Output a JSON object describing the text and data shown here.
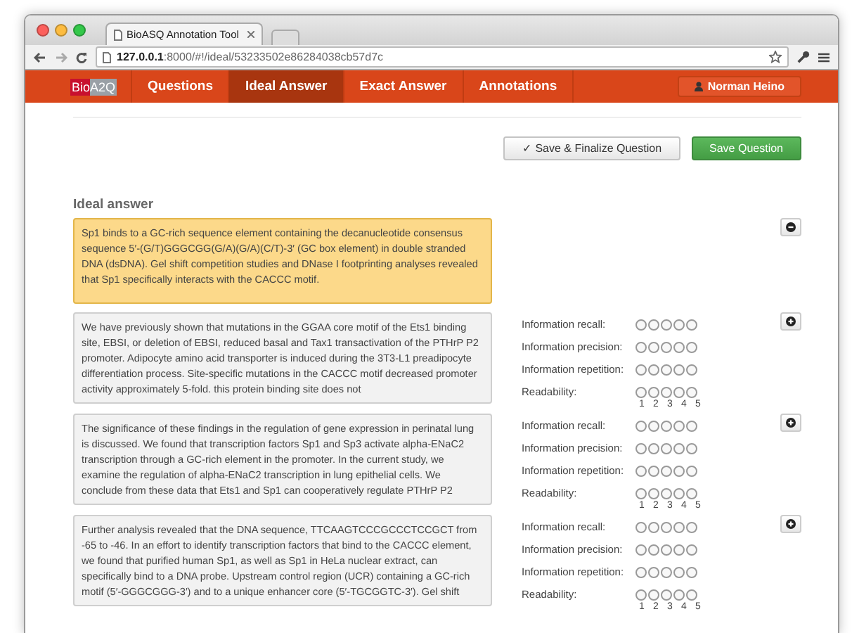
{
  "browser": {
    "tab_title": "BioASQ Annotation Tool",
    "url": "**127.0.0.1**:8000/#!/ideal/53233502e86284038cb57d7c"
  },
  "navbar": {
    "logo": {
      "part_1": "Bio",
      "part_2": "A2Q"
    },
    "items": [
      {
        "label": "Questions",
        "selected": false
      },
      {
        "label": "Ideal Answer",
        "selected": true
      },
      {
        "label": "Exact Answer",
        "selected": false
      },
      {
        "label": "Annotations",
        "selected": false
      }
    ],
    "user": "Norman Heino"
  },
  "actions": {
    "finalize": "✓ Save & Finalize Question",
    "save": "Save Question"
  },
  "ideal_answer": {
    "heading": "Ideal answer",
    "text": "Sp1 binds to a GC-rich sequence element containing the decanucleotide consensus sequence 5′-(G/T)GGGCGG(G/A)(G/A)(C/T)-3′ (GC box element) in double stranded DNA (dsDNA). Gel shift competition studies and DNase I footprinting analyses revealed that Sp1 specifically interacts with the CACCC motif."
  },
  "snippets": [
    {
      "text": "We have previously shown that mutations in the GGAA core motif of the Ets1 binding site, EBSI, or deletion of EBSI, reduced basal and Tax1 transactivation of the PTHrP P2 promoter. Adipocyte amino acid transporter is induced during the 3T3-L1 preadipocyte differentiation process. Site-specific mutations in the CACCC motif decreased promoter activity approximately 5-fold. this protein binding site does not",
      "criteria": [
        {
          "label": "Information recall:",
          "radios": [
            {
              "selected": false
            },
            {
              "selected": false
            },
            {
              "selected": false
            },
            {
              "selected": false
            },
            {
              "selected": false
            }
          ]
        },
        {
          "label": "Information precision:",
          "radios": [
            {
              "selected": false
            },
            {
              "selected": false
            },
            {
              "selected": false
            },
            {
              "selected": false
            },
            {
              "selected": false
            }
          ]
        },
        {
          "label": "Information repetition:",
          "radios": [
            {
              "selected": false
            },
            {
              "selected": false
            },
            {
              "selected": false
            },
            {
              "selected": false
            },
            {
              "selected": false
            }
          ]
        },
        {
          "label": "Readability:",
          "radios": [
            {
              "selected": false
            },
            {
              "selected": false
            },
            {
              "selected": false
            },
            {
              "selected": false
            },
            {
              "selected": false
            }
          ]
        }
      ],
      "scale": [
        "1",
        "2",
        "3",
        "4",
        "5"
      ]
    },
    {
      "text": "The significance of these findings in the regulation of gene expression in perinatal lung is discussed. We found that transcription factors Sp1 and Sp3 activate alpha-ENaC2 transcription through a GC-rich element in the promoter. In the current study, we examine the regulation of alpha-ENaC2 transcription in lung epithelial cells. We conclude from these data that Ets1 and Sp1 can cooperatively regulate PTHrP P2",
      "criteria": [
        {
          "label": "Information recall:",
          "radios": [
            {
              "selected": false
            },
            {
              "selected": false
            },
            {
              "selected": false
            },
            {
              "selected": false
            },
            {
              "selected": false
            }
          ]
        },
        {
          "label": "Information precision:",
          "radios": [
            {
              "selected": false
            },
            {
              "selected": false
            },
            {
              "selected": false
            },
            {
              "selected": false
            },
            {
              "selected": false
            }
          ]
        },
        {
          "label": "Information repetition:",
          "radios": [
            {
              "selected": false
            },
            {
              "selected": false
            },
            {
              "selected": false
            },
            {
              "selected": false
            },
            {
              "selected": false
            }
          ]
        },
        {
          "label": "Readability:",
          "radios": [
            {
              "selected": false
            },
            {
              "selected": false
            },
            {
              "selected": false
            },
            {
              "selected": false
            },
            {
              "selected": false
            }
          ]
        }
      ],
      "scale": [
        "1",
        "2",
        "3",
        "4",
        "5"
      ]
    },
    {
      "text": "Further analysis revealed that the DNA sequence, TTCAAGTCCCGCCCTCCGCT from -65 to -46. In an effort to identify transcription factors that bind to the CACCC element, we found that purified human Sp1, as well as Sp1 in HeLa nuclear extract, can specifically bind to a DNA probe. Upstream control region (UCR) containing a GC-rich motif (5′-GGGCGGG-3′) and to a unique enhancer core (5′-TGCGGTC-3′). Gel shift",
      "criteria": [
        {
          "label": "Information recall:",
          "radios": [
            {
              "selected": false
            },
            {
              "selected": false
            },
            {
              "selected": false
            },
            {
              "selected": false
            },
            {
              "selected": false
            }
          ]
        },
        {
          "label": "Information precision:",
          "radios": [
            {
              "selected": false
            },
            {
              "selected": false
            },
            {
              "selected": false
            },
            {
              "selected": false
            },
            {
              "selected": false
            }
          ]
        },
        {
          "label": "Information repetition:",
          "radios": [
            {
              "selected": false
            },
            {
              "selected": false
            },
            {
              "selected": false
            },
            {
              "selected": false
            },
            {
              "selected": false
            }
          ]
        },
        {
          "label": "Readability:",
          "radios": [
            {
              "selected": false
            },
            {
              "selected": false
            },
            {
              "selected": false
            },
            {
              "selected": false
            },
            {
              "selected": false
            }
          ]
        }
      ],
      "scale": [
        "1",
        "2",
        "3",
        "4",
        "5"
      ]
    }
  ]
}
